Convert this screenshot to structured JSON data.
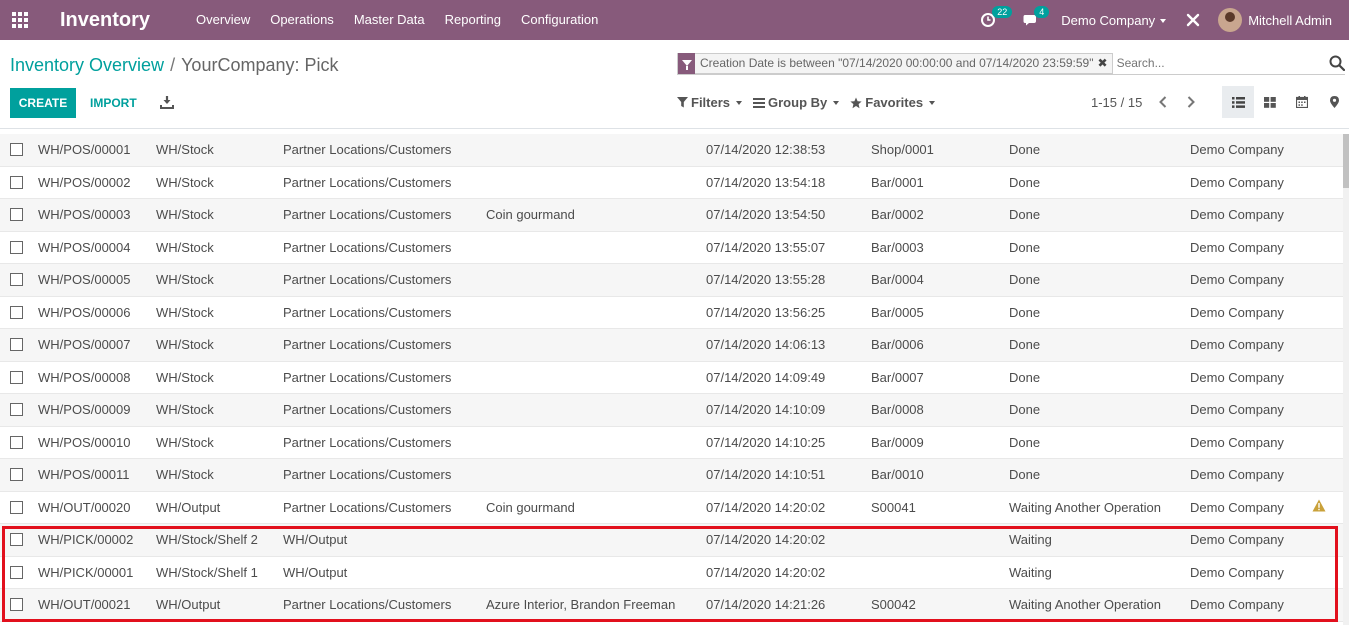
{
  "topbar": {
    "app_name": "Inventory",
    "menu": [
      "Overview",
      "Operations",
      "Master Data",
      "Reporting",
      "Configuration"
    ],
    "activity_count": "22",
    "message_count": "4",
    "company": "Demo Company",
    "user": "Mitchell Admin"
  },
  "breadcrumb": {
    "parent": "Inventory Overview",
    "separator": "/",
    "current": "YourCompany: Pick"
  },
  "search": {
    "facet": "Creation Date is between \"07/14/2020 00:00:00 and 07/14/2020 23:59:59\"",
    "placeholder": "Search..."
  },
  "buttons": {
    "create": "CREATE",
    "import": "IMPORT"
  },
  "filters": {
    "filters": "Filters",
    "group_by": "Group By",
    "favorites": "Favorites"
  },
  "pager": {
    "range": "1-15 / 15"
  },
  "colors": {
    "brand": "#875a7b",
    "accent": "#00a09d",
    "highlight": "#e2101d",
    "warning": "#c9a13a"
  },
  "rows": [
    {
      "ref": "WH/POS/00001",
      "from": "WH/Stock",
      "to": "Partner Locations/Customers",
      "contact": "",
      "date": "07/14/2020 12:38:53",
      "source": "Shop/0001",
      "status": "Done",
      "company": "Demo Company",
      "warn": false
    },
    {
      "ref": "WH/POS/00002",
      "from": "WH/Stock",
      "to": "Partner Locations/Customers",
      "contact": "",
      "date": "07/14/2020 13:54:18",
      "source": "Bar/0001",
      "status": "Done",
      "company": "Demo Company",
      "warn": false
    },
    {
      "ref": "WH/POS/00003",
      "from": "WH/Stock",
      "to": "Partner Locations/Customers",
      "contact": "Coin gourmand",
      "date": "07/14/2020 13:54:50",
      "source": "Bar/0002",
      "status": "Done",
      "company": "Demo Company",
      "warn": false
    },
    {
      "ref": "WH/POS/00004",
      "from": "WH/Stock",
      "to": "Partner Locations/Customers",
      "contact": "",
      "date": "07/14/2020 13:55:07",
      "source": "Bar/0003",
      "status": "Done",
      "company": "Demo Company",
      "warn": false
    },
    {
      "ref": "WH/POS/00005",
      "from": "WH/Stock",
      "to": "Partner Locations/Customers",
      "contact": "",
      "date": "07/14/2020 13:55:28",
      "source": "Bar/0004",
      "status": "Done",
      "company": "Demo Company",
      "warn": false
    },
    {
      "ref": "WH/POS/00006",
      "from": "WH/Stock",
      "to": "Partner Locations/Customers",
      "contact": "",
      "date": "07/14/2020 13:56:25",
      "source": "Bar/0005",
      "status": "Done",
      "company": "Demo Company",
      "warn": false
    },
    {
      "ref": "WH/POS/00007",
      "from": "WH/Stock",
      "to": "Partner Locations/Customers",
      "contact": "",
      "date": "07/14/2020 14:06:13",
      "source": "Bar/0006",
      "status": "Done",
      "company": "Demo Company",
      "warn": false
    },
    {
      "ref": "WH/POS/00008",
      "from": "WH/Stock",
      "to": "Partner Locations/Customers",
      "contact": "",
      "date": "07/14/2020 14:09:49",
      "source": "Bar/0007",
      "status": "Done",
      "company": "Demo Company",
      "warn": false
    },
    {
      "ref": "WH/POS/00009",
      "from": "WH/Stock",
      "to": "Partner Locations/Customers",
      "contact": "",
      "date": "07/14/2020 14:10:09",
      "source": "Bar/0008",
      "status": "Done",
      "company": "Demo Company",
      "warn": false
    },
    {
      "ref": "WH/POS/00010",
      "from": "WH/Stock",
      "to": "Partner Locations/Customers",
      "contact": "",
      "date": "07/14/2020 14:10:25",
      "source": "Bar/0009",
      "status": "Done",
      "company": "Demo Company",
      "warn": false
    },
    {
      "ref": "WH/POS/00011",
      "from": "WH/Stock",
      "to": "Partner Locations/Customers",
      "contact": "",
      "date": "07/14/2020 14:10:51",
      "source": "Bar/0010",
      "status": "Done",
      "company": "Demo Company",
      "warn": false
    },
    {
      "ref": "WH/OUT/00020",
      "from": "WH/Output",
      "to": "Partner Locations/Customers",
      "contact": "Coin gourmand",
      "date": "07/14/2020 14:20:02",
      "source": "S00041",
      "status": "Waiting Another Operation",
      "company": "Demo Company",
      "warn": true
    },
    {
      "ref": "WH/PICK/00002",
      "from": "WH/Stock/Shelf 2",
      "to": "WH/Output",
      "contact": "",
      "date": "07/14/2020 14:20:02",
      "source": "",
      "status": "Waiting",
      "company": "Demo Company",
      "warn": false
    },
    {
      "ref": "WH/PICK/00001",
      "from": "WH/Stock/Shelf 1",
      "to": "WH/Output",
      "contact": "",
      "date": "07/14/2020 14:20:02",
      "source": "",
      "status": "Waiting",
      "company": "Demo Company",
      "warn": false
    },
    {
      "ref": "WH/OUT/00021",
      "from": "WH/Output",
      "to": "Partner Locations/Customers",
      "contact": "Azure Interior, Brandon Freeman",
      "date": "07/14/2020 14:21:26",
      "source": "S00042",
      "status": "Waiting Another Operation",
      "company": "Demo Company",
      "warn": false
    }
  ]
}
